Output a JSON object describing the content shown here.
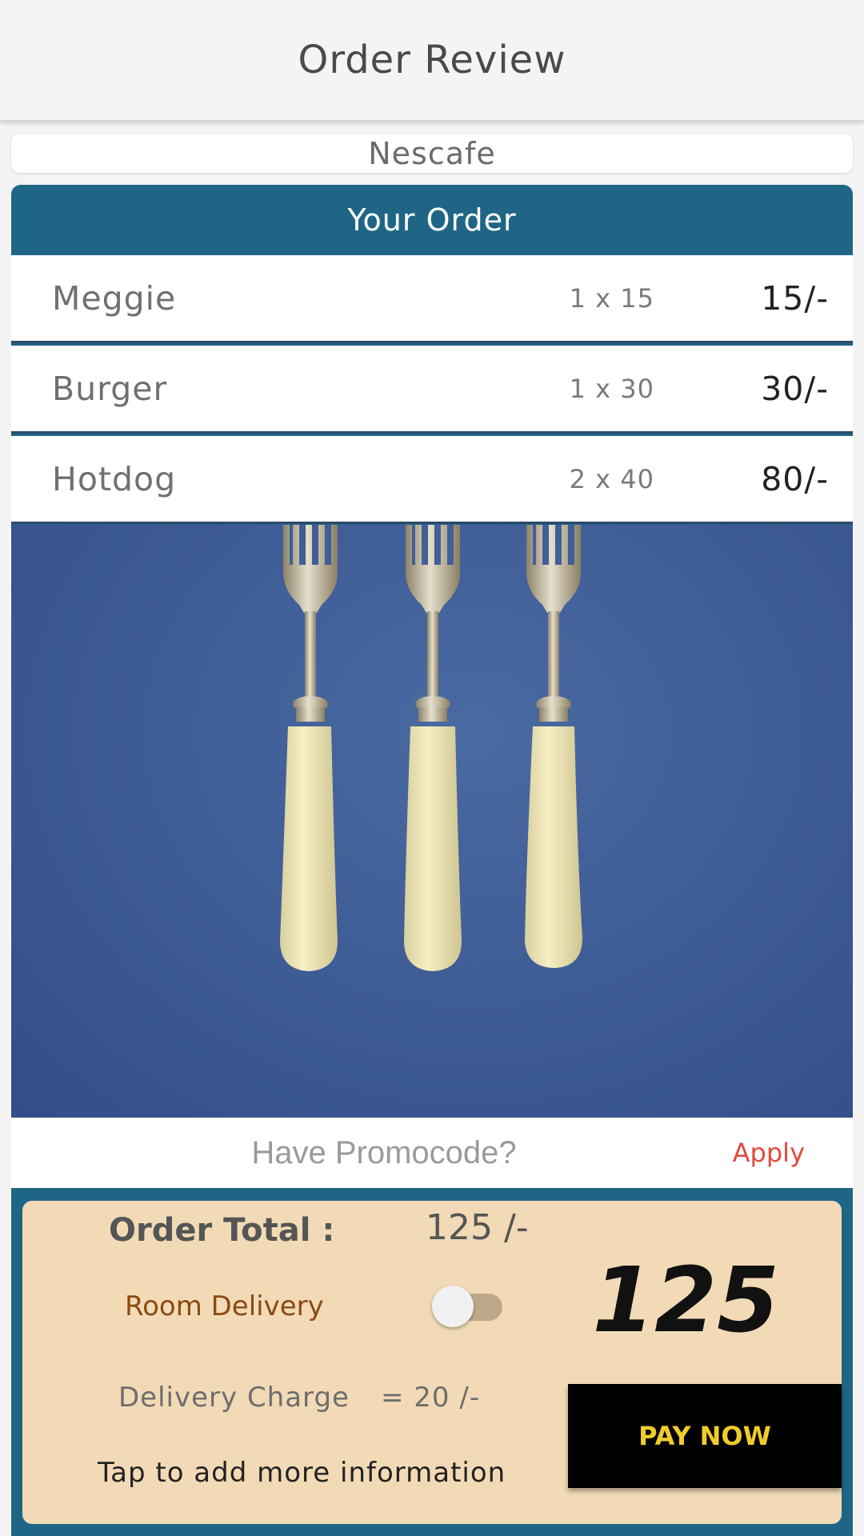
{
  "header": {
    "title": "Order Review"
  },
  "restaurant": {
    "name": "Nescafe"
  },
  "order": {
    "title": "Your Order",
    "items": [
      {
        "name": "Meggie",
        "qty": "1 x 15",
        "total": "15/-"
      },
      {
        "name": "Burger",
        "qty": "1 x 30",
        "total": "30/-"
      },
      {
        "name": "Hotdog",
        "qty": "2 x 40",
        "total": "80/-"
      }
    ]
  },
  "promo": {
    "placeholder": "Have Promocode?",
    "apply_label": "Apply"
  },
  "summary": {
    "total_label": "Order Total :",
    "total_value": "125 /-",
    "big_total": "125",
    "room_delivery_label": "Room Delivery",
    "room_delivery_enabled": false,
    "delivery_label": "Delivery Charge",
    "delivery_value": "= 20 /-",
    "more_info": "Tap to add more information",
    "pay_label": "PAY NOW"
  },
  "colors": {
    "header_bg": "#1f6686",
    "summary_bg": "#f2dab6",
    "pay_text": "#f0cc2a",
    "apply_text": "#e04a3e"
  }
}
